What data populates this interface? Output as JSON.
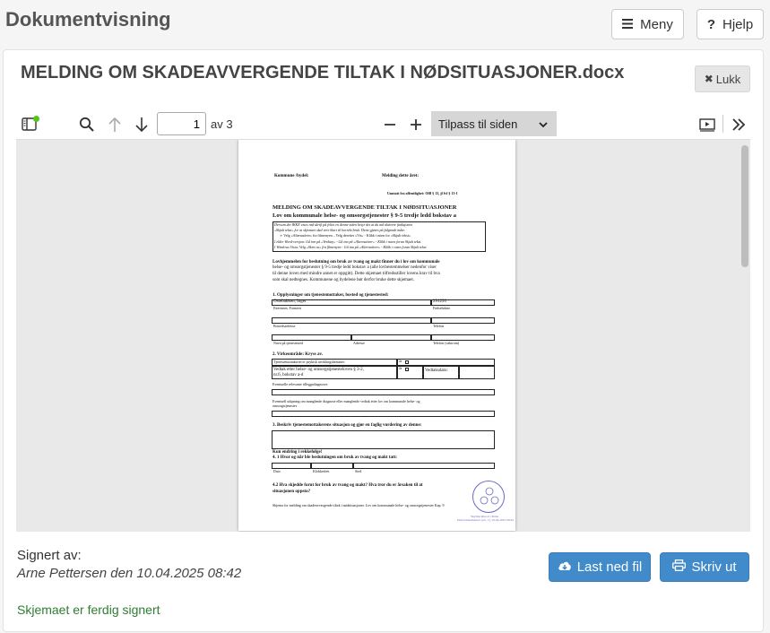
{
  "header": {
    "title": "Dokumentvisning",
    "menu_label": "Meny",
    "help_label": "Hjelp"
  },
  "document": {
    "filename": "MELDING OM SKADEAVVERGENDE TILTAK I NØDSITUASJONER.docx",
    "close_label": "Lukk"
  },
  "toolbar": {
    "current_page": "1",
    "page_of": "av 3",
    "zoom_selected": "Tilpass til siden",
    "icons": [
      "sidebar-toggle-icon",
      "search-icon",
      "arrow-up-icon",
      "arrow-down-icon",
      "zoom-out-icon",
      "zoom-in-icon",
      "presentation-icon",
      "double-chevron-right-icon"
    ]
  },
  "page": {
    "kommune": "Kommune /bydel:",
    "meldt": "Melding dette året:",
    "unntatt": "Unntatt fra offentlighet: Offl § 13, jf fvl § 13-1",
    "title1": "MELDING OM SKADEAVVERGENDE TILTAK I NØDSITUASJONER",
    "title2": "Lov om kommunale helse- og omsorgstjenester § 9-5 tredje ledd bokstav a",
    "info1": "Dersom det IKKE vises rød skrift på feltet en denne siden betyr det at du må aktivere funksjonen",
    "info2": "«Skjult tekst» for at skjemaet skal vere klart til korrekt bruk. Dette gjøres på følgende måte:",
    "info3": "➢   Velg «Alternativer» fra filmenyen – Velg deretter «Vis» - Klikk i ruten for «Skjult tekst»",
    "info4": "I eldre Word-versjon: Gå inn på «Verktøy» - Gå inn på «Alternativer» - Klikk i ruten foran Skjult tekst.",
    "info5": "I Windows Vista: Velg «Skriv ut» fra filmenyen - Gå inn på «Alternativer» - Klikk i ruten foran Skjult tekst",
    "lovhj1": "Lovhjemmelen for beslutning om bruk av tvang og makt finner du i lov om kommunale",
    "lovhj2": "helse- og omsorgstjenester § 9-5 tredje ledd bokstav a (alle lovbestemmelser nedenfor viser",
    "lovhj3": "til denne loven med mindre annet er oppgitt). Dette skjemaet tilfredsstiller lovens krav til hva",
    "lovhj4": "som skal nedtegnes. Kommunene og bydelene bør derfor bruke dette skjemaet.",
    "sec1": "1. Opplysninger om tjenestemottaker, bosted og tjenestested:",
    "name": "Ostebakken, Inger",
    "birth": "291293",
    "lbl_name": "Etternavn, Fornavn",
    "lbl_birth": "Fødselsdato",
    "lbl_addr": "Bostedsadresse",
    "lbl_phone": "Telefon",
    "lbl_verge": "Navn på tjenestested",
    "lbl_vaddr": "Adresse",
    "lbl_vphone": "Telefon (vaktrom)",
    "sec2": "2. Virkeområde: Kryss av.",
    "v1": "Tjenestemottakeren er psykisk utviklingshemmet:",
    "v2": "Vedtak etter helse- og omsorgstjenesteloven § 3-2,",
    "v3": "nr.6, bokstav a-d",
    "ja": "Ja",
    "vdato": "Vedtaksdato:",
    "diag": "Eventuelle relevante tilleggsdiagnoser:",
    "utred1": "Eventuell utkpning om manglende diagnose eller manglende vedtak etter lov om kommunale helse- og",
    "utred2": "omsorgstjenester",
    "sec3": "3. Beskriv tjenestemottakerens situasjon og gjør en faglig vurdering av denne:",
    "kun": "Kun endring i rekkefølge!",
    "sec41": "4. 1 Hvor og når ble beslutningen om bruk av tvang og makt tatt:",
    "lbl_date": "Dato",
    "lbl_time": "Klokkeslett",
    "lbl_place": "Sted",
    "sec421": "4.2 Hva skjedde forut for bruk av tvang og makt? Hva tror du er årsaken til at",
    "sec422": "situasjonen oppsto?",
    "footer": "Skjema for melding om skadeavvergende tiltak i nødsituasjoner. Lov om kommunale helse- og omsorgstjenester Kap. 9",
    "stamp_text1": "Skyfisk import i Dabe",
    "stamp_text2": "Dabe Dokumenter (ver. 1), 10.04.2025 08:42"
  },
  "signature": {
    "label": "Signert av:",
    "signed_by": "Arne Pettersen den 10.04.2025 08:42",
    "status": "Skjemaet er ferdig signert",
    "status_color": "#2e7d32"
  },
  "actions": {
    "download_label": "Last ned fil",
    "print_label": "Skriv ut",
    "accent": "#428bca"
  }
}
